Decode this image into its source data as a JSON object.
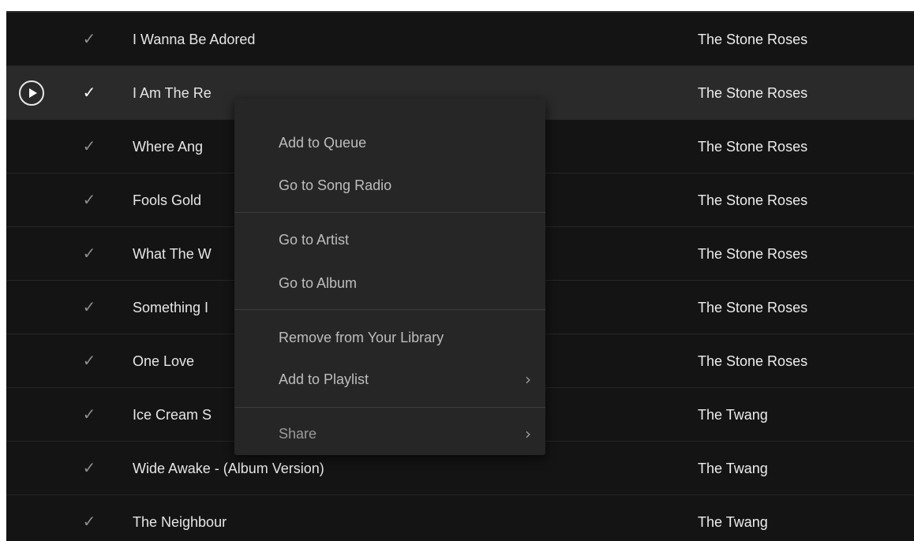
{
  "tracks": [
    {
      "title": "I Wanna Be Adored",
      "artist": "The Stone Roses"
    },
    {
      "title": "I Am The Re",
      "artist": "The Stone Roses"
    },
    {
      "title": "Where Ang",
      "artist": "The Stone Roses"
    },
    {
      "title": "Fools Gold",
      "artist": "The Stone Roses"
    },
    {
      "title": "What The W",
      "artist": "The Stone Roses"
    },
    {
      "title": "Something I",
      "artist": "The Stone Roses"
    },
    {
      "title": "One Love",
      "artist": "The Stone Roses"
    },
    {
      "title": "Ice Cream S",
      "artist": "The Twang"
    },
    {
      "title": "Wide Awake - (Album Version)",
      "artist": "The Twang"
    },
    {
      "title": "The Neighbour",
      "artist": "The Twang"
    }
  ],
  "saved_icon": "checkmark-icon",
  "play_icon": "play-circle-icon",
  "context_menu": {
    "add_to_queue": "Add to Queue",
    "go_to_song_radio": "Go to Song Radio",
    "go_to_artist": "Go to Artist",
    "go_to_album": "Go to Album",
    "remove_from_library": "Remove from Your Library",
    "add_to_playlist": "Add to Playlist",
    "share": "Share"
  },
  "colors": {
    "background": "#141414",
    "active_row": "#2a2a2a",
    "menu_background": "#262626",
    "text": "#e6e6e6",
    "menu_text": "#bdbdbd"
  }
}
